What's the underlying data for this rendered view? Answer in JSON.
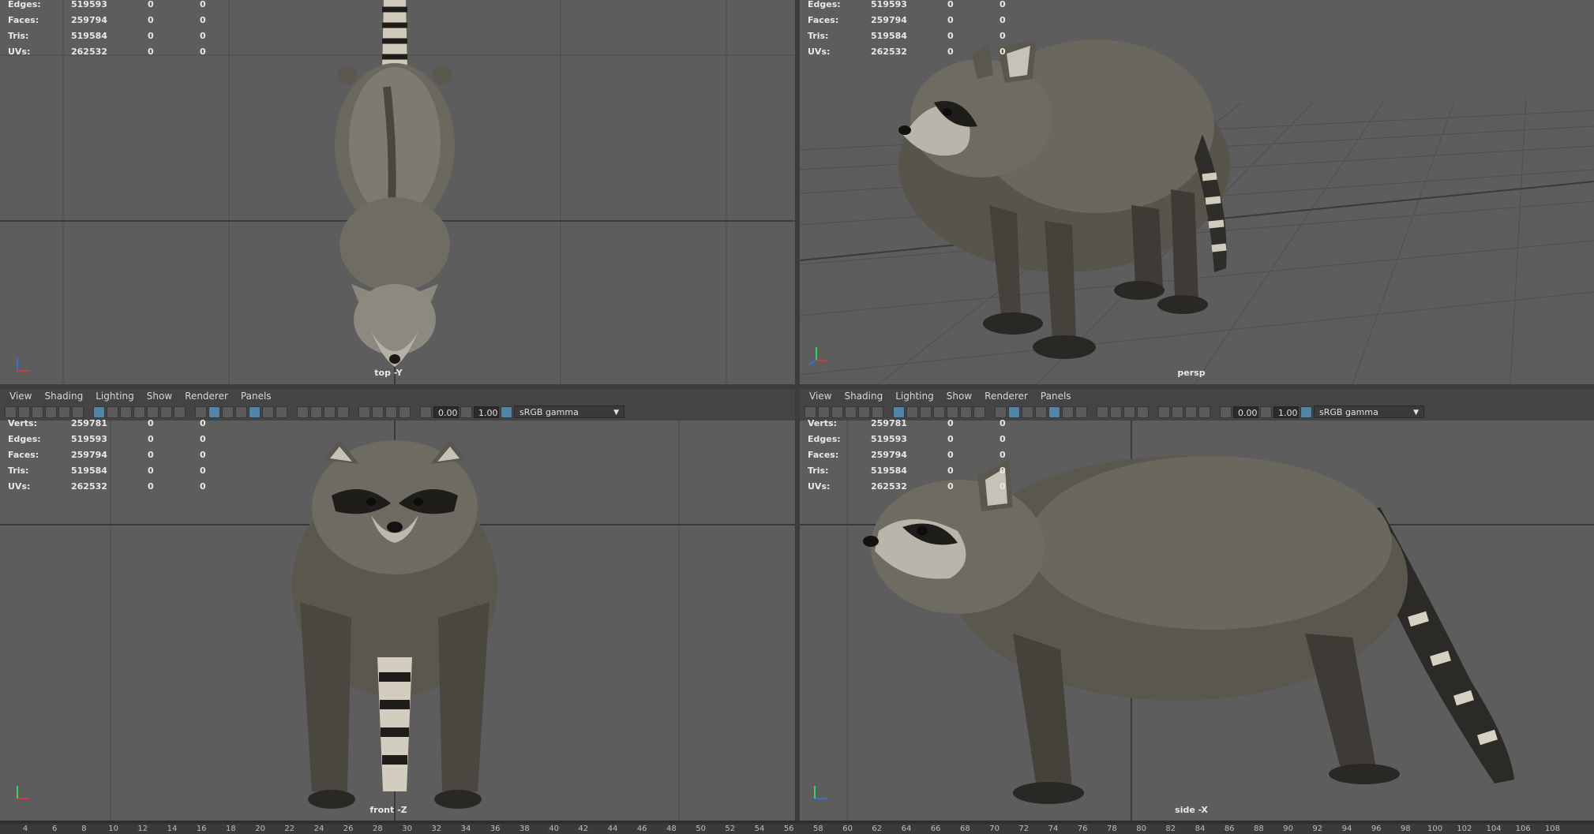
{
  "menu": [
    "View",
    "Shading",
    "Lighting",
    "Show",
    "Renderer",
    "Panels"
  ],
  "toolbar": {
    "exposure": "0.00",
    "gamma": "1.00",
    "color_space": "sRGB gamma"
  },
  "hud_rows": [
    {
      "label": "Verts:",
      "value": "259781",
      "sel": "0",
      "extra": "0"
    },
    {
      "label": "Edges:",
      "value": "519593",
      "sel": "0",
      "extra": "0"
    },
    {
      "label": "Faces:",
      "value": "259794",
      "sel": "0",
      "extra": "0"
    },
    {
      "label": "Tris:",
      "value": "519584",
      "sel": "0",
      "extra": "0"
    },
    {
      "label": "UVs:",
      "value": "262532",
      "sel": "0",
      "extra": "0"
    }
  ],
  "viewports": {
    "top": {
      "camera": "top -Y"
    },
    "persp": {
      "camera": "persp"
    },
    "front": {
      "camera": "front -Z"
    },
    "side": {
      "camera": "side -X"
    }
  },
  "timeline_ticks": [
    "4",
    "6",
    "8",
    "10",
    "12",
    "14",
    "16",
    "18",
    "20",
    "22",
    "24",
    "26",
    "28",
    "30",
    "32",
    "34",
    "36",
    "38",
    "40",
    "42",
    "44",
    "46",
    "48",
    "50",
    "52",
    "54",
    "56",
    "58",
    "60",
    "62",
    "64",
    "66",
    "68",
    "70",
    "72",
    "74",
    "76",
    "78",
    "80",
    "82",
    "84",
    "86",
    "88",
    "90",
    "92",
    "94",
    "96",
    "98",
    "100",
    "102",
    "104",
    "106",
    "108"
  ],
  "colors": {
    "viewport_bg": "#5d5d5d",
    "grid": "#4a4a4a",
    "grid_axis": "#3b3b3b",
    "accent": "#5285a6",
    "fur": "#5a574f"
  }
}
